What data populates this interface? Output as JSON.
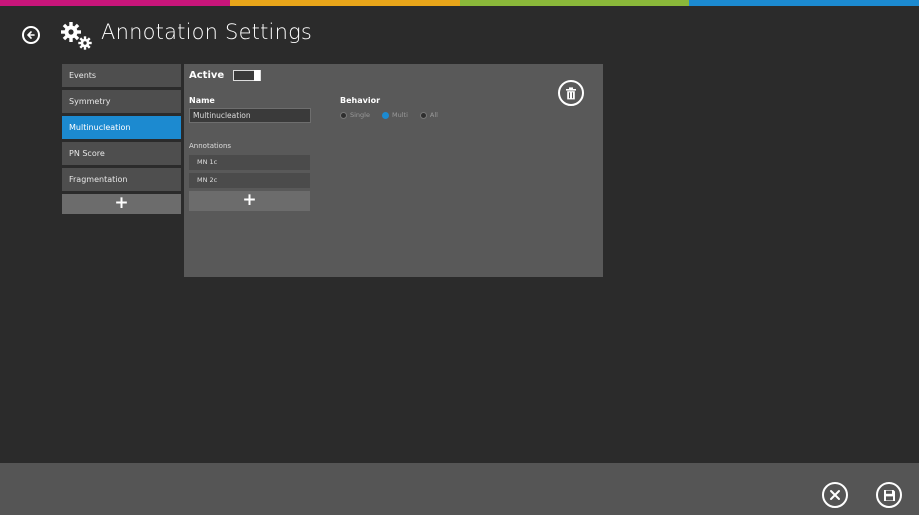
{
  "colors": {
    "accent_strip": [
      "#c8157a",
      "#e8a51a",
      "#8ab83a",
      "#1c8ad0"
    ],
    "selected": "#1c8ad0",
    "background": "#2b2b2b",
    "panel": "#595959",
    "footer": "#555555"
  },
  "header": {
    "back_icon": "back-arrow-icon",
    "settings_icon": "gears-icon",
    "title": "Annotation Settings"
  },
  "sidebar": {
    "items": [
      {
        "label": "Events",
        "selected": false
      },
      {
        "label": "Symmetry",
        "selected": false
      },
      {
        "label": "Multinucleation",
        "selected": true
      },
      {
        "label": "PN Score",
        "selected": false
      },
      {
        "label": "Fragmentation",
        "selected": false
      }
    ],
    "add_label": "+"
  },
  "detail": {
    "active_label": "Active",
    "active_on": true,
    "name_label": "Name",
    "name_value": "Multinucleation",
    "behavior_label": "Behavior",
    "behavior_options": [
      {
        "label": "Single",
        "checked": false
      },
      {
        "label": "Multi",
        "checked": true
      },
      {
        "label": "All",
        "checked": false
      }
    ],
    "delete_icon": "trash-icon",
    "annotations_label": "Annotations",
    "annotations": [
      "MN 1c",
      "MN 2c"
    ],
    "add_label": "+"
  },
  "footer": {
    "cancel_icon": "close-icon",
    "save_icon": "save-icon"
  }
}
